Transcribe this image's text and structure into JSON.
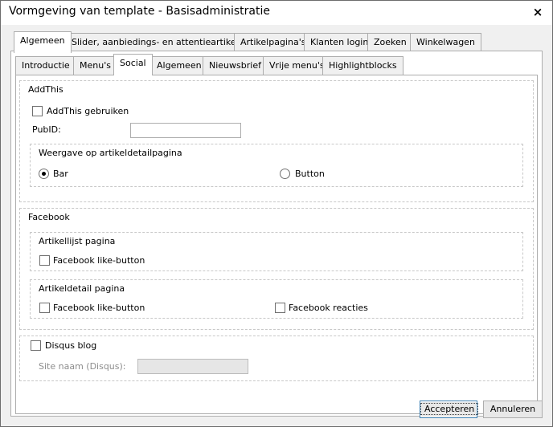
{
  "window": {
    "title": "Vormgeving van template - Basisadministratie",
    "close_symbol": "×"
  },
  "top_tabs": [
    {
      "label": "Algemeen",
      "active": true
    },
    {
      "label": "Slider, aanbiedings- en attentieartikelen",
      "active": false
    },
    {
      "label": "Artikelpagina's",
      "active": false
    },
    {
      "label": "Klanten login",
      "active": false
    },
    {
      "label": "Zoeken",
      "active": false
    },
    {
      "label": "Winkelwagen",
      "active": false
    }
  ],
  "sub_tabs": [
    {
      "label": "Introductie",
      "active": false
    },
    {
      "label": "Menu's",
      "active": false
    },
    {
      "label": "Social",
      "active": true
    },
    {
      "label": "Algemeen",
      "active": false
    },
    {
      "label": "Nieuwsbrief",
      "active": false
    },
    {
      "label": "Vrije menu's",
      "active": false
    },
    {
      "label": "Highlightblocks",
      "active": false
    }
  ],
  "addthis": {
    "title": "AddThis",
    "use_label": "AddThis gebruiken",
    "use_checked": false,
    "pubid_label": "PubID:",
    "pubid_value": "",
    "display_group": {
      "title": "Weergave op artikeldetailpagina",
      "option_bar": "Bar",
      "option_button": "Button",
      "selected": "Bar"
    }
  },
  "facebook": {
    "title": "Facebook",
    "list_group": {
      "title": "Artikellijst pagina",
      "like_label": "Facebook like-button",
      "like_checked": false
    },
    "detail_group": {
      "title": "Artikeldetail pagina",
      "like_label": "Facebook like-button",
      "like_checked": false,
      "reactions_label": "Facebook reacties",
      "reactions_checked": false
    }
  },
  "disqus": {
    "blog_label": "Disqus blog",
    "blog_checked": false,
    "site_label": "Site naam (Disqus):",
    "site_value": ""
  },
  "buttons": {
    "accept": "Accepteren",
    "cancel": "Annuleren"
  }
}
